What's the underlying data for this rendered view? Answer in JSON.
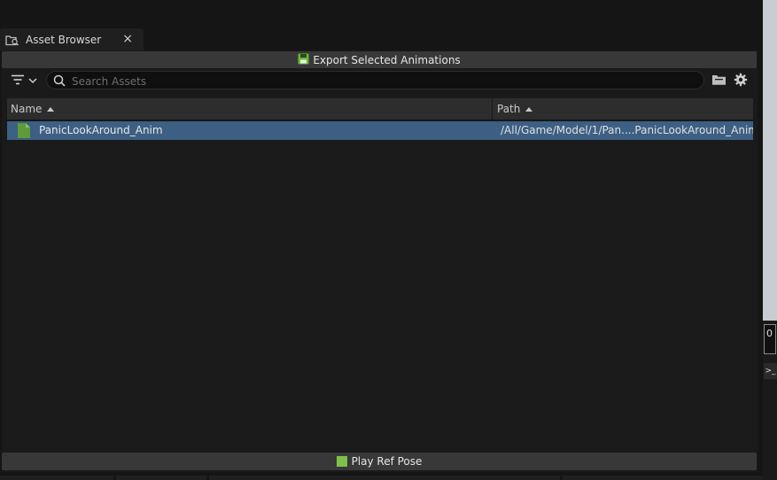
{
  "tab": {
    "label": "Asset Browser",
    "close_glyph": "×",
    "icon": "asset-browser-icon"
  },
  "toolbar": {
    "export_label": "Export Selected Animations",
    "export_icon": "save-icon"
  },
  "search": {
    "placeholder": "Search Assets",
    "value": ""
  },
  "table": {
    "columns": [
      "Name",
      "Path"
    ],
    "rows": [
      {
        "name": "PanicLookAround_Anim",
        "path": "/All/Game/Model/1/Pan....PanicLookAround_Anim",
        "selected": true
      }
    ]
  },
  "footer": {
    "play_label": "Play Ref Pose"
  },
  "side": {
    "field_value": "0"
  },
  "colors": {
    "selection": "#3d5f83",
    "accent_green": "#7fc04a",
    "background": "#1a1a1a"
  }
}
